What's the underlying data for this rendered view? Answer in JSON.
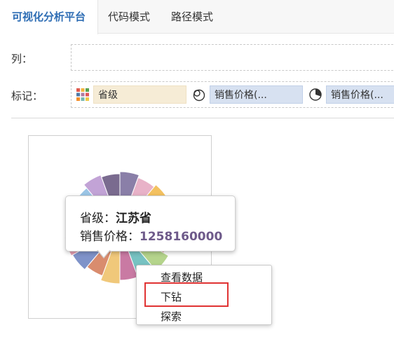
{
  "tabs": [
    {
      "label": "可视化分析平台",
      "active": true
    },
    {
      "label": "代码模式",
      "active": false
    },
    {
      "label": "路径模式",
      "active": false
    }
  ],
  "rows": {
    "columns_label": "列：",
    "marks_label": "标记："
  },
  "marks": [
    {
      "icon": "color-grid-icon",
      "field": "省级"
    },
    {
      "icon": "size-circles-icon",
      "field": "销售价格(..."
    },
    {
      "icon": "pie-angle-icon",
      "field": "销售价格(..."
    }
  ],
  "tooltip": {
    "line1_label": "省级：",
    "line1_value": "江苏省",
    "line2_label": "销售价格：",
    "line2_value": "1258160000"
  },
  "context_menu": {
    "items": [
      "查看数据",
      "下钻",
      "探索"
    ],
    "highlighted_item": "下钻"
  },
  "chart_data": {
    "type": "pie",
    "slice_colors": [
      "#8a7fa8",
      "#e8b2c8",
      "#f3c160",
      "#6aa3d6",
      "#9a8ab5",
      "#e59a8c",
      "#b5d48c",
      "#77c2c2",
      "#c97aa3",
      "#f0c87a",
      "#d98c6e",
      "#7f93c9",
      "#e6a0b4",
      "#a8c97a",
      "#f4b760",
      "#9bc5e6",
      "#c2a3d6",
      "#7a6b8f"
    ]
  }
}
